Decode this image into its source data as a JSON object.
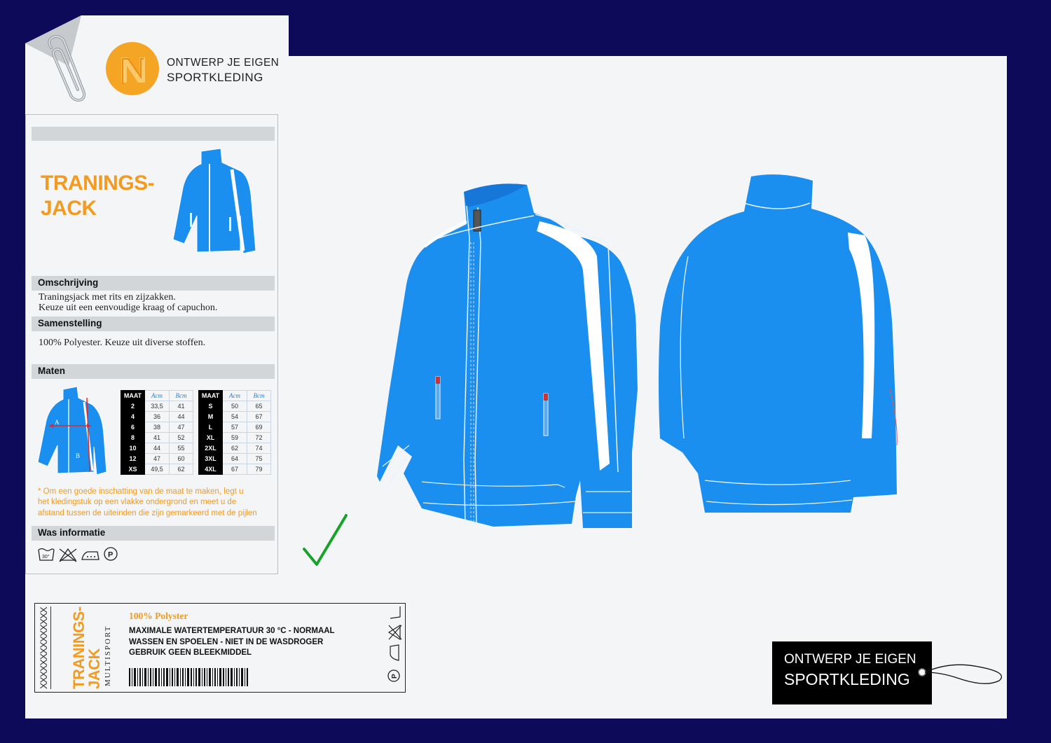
{
  "brand": {
    "line1": "ONTWERP JE EIGEN",
    "line2": "SPORTKLEDING"
  },
  "product": {
    "title_line1": "TRANINGS-",
    "title_line2": "JACK"
  },
  "sections": {
    "description_header": "Omschrijving",
    "description_line1": "Traningsjack met rits en zijzakken.",
    "description_line2": "Keuze uit een eenvoudige kraag of capuchon.",
    "composition_header": "Samenstelling",
    "composition_text": "100% Polyester. Keuze uit diverse stoffen.",
    "sizes_header": "Maten",
    "wash_header": "Was informatie"
  },
  "size_diagram": {
    "label_a": "A",
    "label_b": "B"
  },
  "size_table": {
    "headers": [
      "MAAT",
      "Acm",
      "Bcm"
    ],
    "kids": [
      [
        "2",
        "33,5",
        "41"
      ],
      [
        "4",
        "36",
        "44"
      ],
      [
        "6",
        "38",
        "47"
      ],
      [
        "8",
        "41",
        "52"
      ],
      [
        "10",
        "44",
        "55"
      ],
      [
        "12",
        "47",
        "60"
      ],
      [
        "XS",
        "49,5",
        "62"
      ]
    ],
    "adults": [
      [
        "S",
        "50",
        "65"
      ],
      [
        "M",
        "54",
        "67"
      ],
      [
        "L",
        "57",
        "69"
      ],
      [
        "XL",
        "59",
        "72"
      ],
      [
        "2XL",
        "62",
        "74"
      ],
      [
        "3XL",
        "64",
        "75"
      ],
      [
        "4XL",
        "67",
        "79"
      ]
    ]
  },
  "note": {
    "line1": "* Om een goede inschatting van de maat te maken, legt u",
    "line2": "het kledingstuk  op een vlakke ondergrond en meet u de",
    "line3": "afstand tussen de uiteinden die zijn gemarkeerd met de pijlen"
  },
  "wash_icons": [
    "wash-30-icon",
    "no-bleach-icon",
    "iron-icon",
    "dryclean-p-icon"
  ],
  "wash_temp": "30°",
  "dryclean_letter": "P",
  "care_label": {
    "side_title_1": "TRANINGS-",
    "side_title_2": "JACK",
    "side_sub": "MULTISPORT",
    "material": "100% Polyster",
    "line1": "MAXIMALE WATERTEMPERATUUR 30 °C - NORMAAL",
    "line2": "WASSEN EN SPOELEN - NIET IN DE WASDROGER",
    "line3": "GEBRUIK GEEN BLEEKMIDDEL",
    "stitch_text": "XXXXXXXXXXXXXX"
  },
  "colors": {
    "jacket_blue": "#1b8ff0",
    "orange": "#f39a1f",
    "navy_bg": "#0d0a5a",
    "check_green": "#17a32a"
  }
}
